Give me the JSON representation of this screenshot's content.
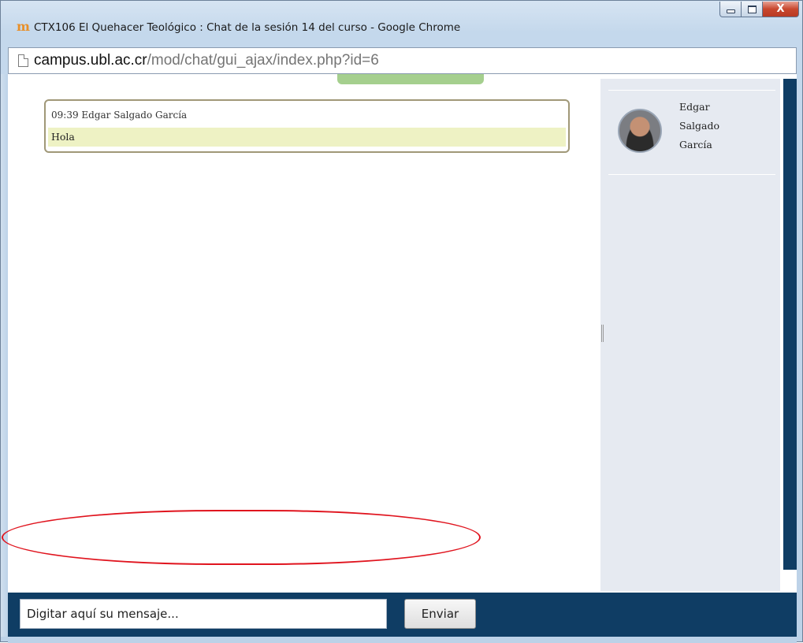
{
  "window": {
    "title": "CTX106 El Quehacer Teológico : Chat de la sesión 14 del curso - Google Chrome",
    "app_icon": "moodle-icon",
    "app_icon_text": "m",
    "controls": {
      "minimize": "minimize-icon",
      "maximize": "maximize-icon",
      "close": "close-icon",
      "close_glyph": "X"
    }
  },
  "address_bar": {
    "host": "campus.ubl.ac.cr",
    "path": "/mod/chat/gui_ajax/index.php?id=6",
    "icon": "page-icon"
  },
  "chat": {
    "messages": [
      {
        "meta": "09:39 Edgar Salgado García",
        "text": "Hola"
      }
    ]
  },
  "users": [
    {
      "name_lines": [
        "Edgar",
        "Salgado",
        "García"
      ]
    }
  ],
  "composer": {
    "placeholder": "Digitar aquí su mensaje...",
    "send_label": "Enviar"
  },
  "colors": {
    "panel_blue": "#0f3d64",
    "highlight_red": "#e0141e",
    "message_bg": "#eef2c4",
    "users_panel_bg": "#e6eaf1"
  }
}
